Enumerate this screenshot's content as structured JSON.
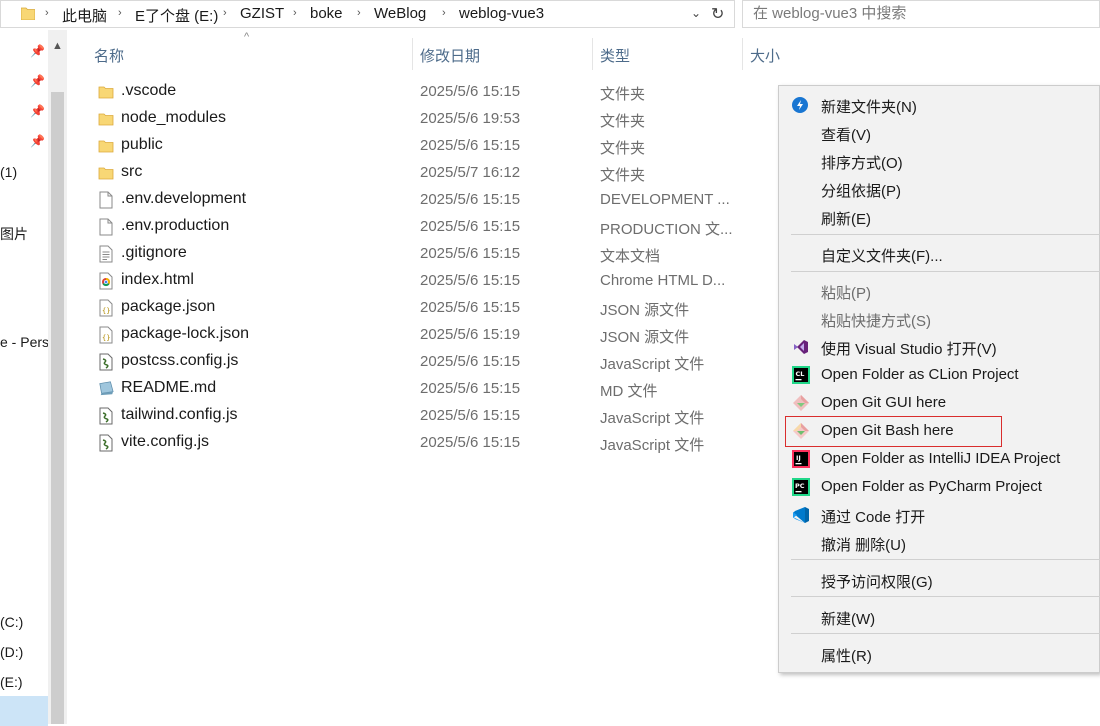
{
  "address": {
    "crumbs": [
      "此电脑",
      "E了个盘 (E:)",
      "GZIST",
      "boke",
      "WeBlog",
      "weblog-vue3"
    ]
  },
  "search": {
    "placeholder": "在 weblog-vue3 中搜索"
  },
  "nav": {
    "partial_labels": [
      "(1)",
      "图片",
      "e - Pers",
      "(C:)",
      "(D:)",
      "(E:)"
    ]
  },
  "columns": {
    "name": "名称",
    "modified": "修改日期",
    "type": "类型",
    "size": "大小"
  },
  "files": [
    {
      "name": ".vscode",
      "date": "2025/5/6 15:15",
      "type": "文件夹",
      "icon": "folder-icon"
    },
    {
      "name": "node_modules",
      "date": "2025/5/6 19:53",
      "type": "文件夹",
      "icon": "folder-icon"
    },
    {
      "name": "public",
      "date": "2025/5/6 15:15",
      "type": "文件夹",
      "icon": "folder-icon"
    },
    {
      "name": "src",
      "date": "2025/5/7 16:12",
      "type": "文件夹",
      "icon": "folder-icon"
    },
    {
      "name": ".env.development",
      "date": "2025/5/6 15:15",
      "type": "DEVELOPMENT ...",
      "icon": "blank-file-icon"
    },
    {
      "name": ".env.production",
      "date": "2025/5/6 15:15",
      "type": "PRODUCTION 文...",
      "icon": "blank-file-icon"
    },
    {
      "name": ".gitignore",
      "date": "2025/5/6 15:15",
      "type": "文本文档",
      "icon": "text-file-icon"
    },
    {
      "name": "index.html",
      "date": "2025/5/6 15:15",
      "type": "Chrome HTML D...",
      "icon": "chrome-html-icon"
    },
    {
      "name": "package.json",
      "date": "2025/5/6 15:15",
      "type": "JSON 源文件",
      "icon": "json-file-icon"
    },
    {
      "name": "package-lock.json",
      "date": "2025/5/6 15:19",
      "type": "JSON 源文件",
      "icon": "json-file-icon"
    },
    {
      "name": "postcss.config.js",
      "date": "2025/5/6 15:15",
      "type": "JavaScript 文件",
      "icon": "js-file-icon"
    },
    {
      "name": "README.md",
      "date": "2025/5/6 15:15",
      "type": "MD 文件",
      "icon": "markdown-file-icon"
    },
    {
      "name": "tailwind.config.js",
      "date": "2025/5/6 15:15",
      "type": "JavaScript 文件",
      "icon": "js-file-icon"
    },
    {
      "name": "vite.config.js",
      "date": "2025/5/6 15:15",
      "type": "JavaScript 文件",
      "icon": "js-file-icon"
    }
  ],
  "context_menu": {
    "items": [
      {
        "label": "新建文件夹(N)",
        "icon": "new-folder-icon",
        "disabled": false
      },
      {
        "label": "查看(V)",
        "icon": "",
        "disabled": false
      },
      {
        "label": "排序方式(O)",
        "icon": "",
        "disabled": false
      },
      {
        "label": "分组依据(P)",
        "icon": "",
        "disabled": false
      },
      {
        "label": "刷新(E)",
        "icon": "",
        "disabled": false
      },
      {
        "label": "自定义文件夹(F)...",
        "icon": "",
        "disabled": false
      },
      {
        "label": "粘贴(P)",
        "icon": "",
        "disabled": true
      },
      {
        "label": "粘贴快捷方式(S)",
        "icon": "",
        "disabled": true
      },
      {
        "label": "使用 Visual Studio 打开(V)",
        "icon": "visual-studio-icon",
        "disabled": false
      },
      {
        "label": "Open Folder as CLion Project",
        "icon": "clion-icon",
        "disabled": false
      },
      {
        "label": "Open Git GUI here",
        "icon": "git-gui-icon",
        "disabled": false
      },
      {
        "label": "Open Git Bash here",
        "icon": "git-bash-icon",
        "disabled": false
      },
      {
        "label": "Open Folder as IntelliJ IDEA Project",
        "icon": "intellij-idea-icon",
        "disabled": false
      },
      {
        "label": "Open Folder as PyCharm Project",
        "icon": "pycharm-icon",
        "disabled": false
      },
      {
        "label": "通过 Code 打开",
        "icon": "vscode-icon",
        "disabled": false
      },
      {
        "label": "撤消 删除(U)",
        "icon": "",
        "disabled": false
      },
      {
        "label": "授予访问权限(G)",
        "icon": "",
        "disabled": false
      },
      {
        "label": "新建(W)",
        "icon": "",
        "disabled": false
      },
      {
        "label": "属性(R)",
        "icon": "",
        "disabled": false
      }
    ]
  },
  "colors": {
    "folder": "#f8d775",
    "selection": "#cce4f7",
    "highlight_box": "#d92d2d",
    "menu_bg": "#f2f2f2"
  }
}
